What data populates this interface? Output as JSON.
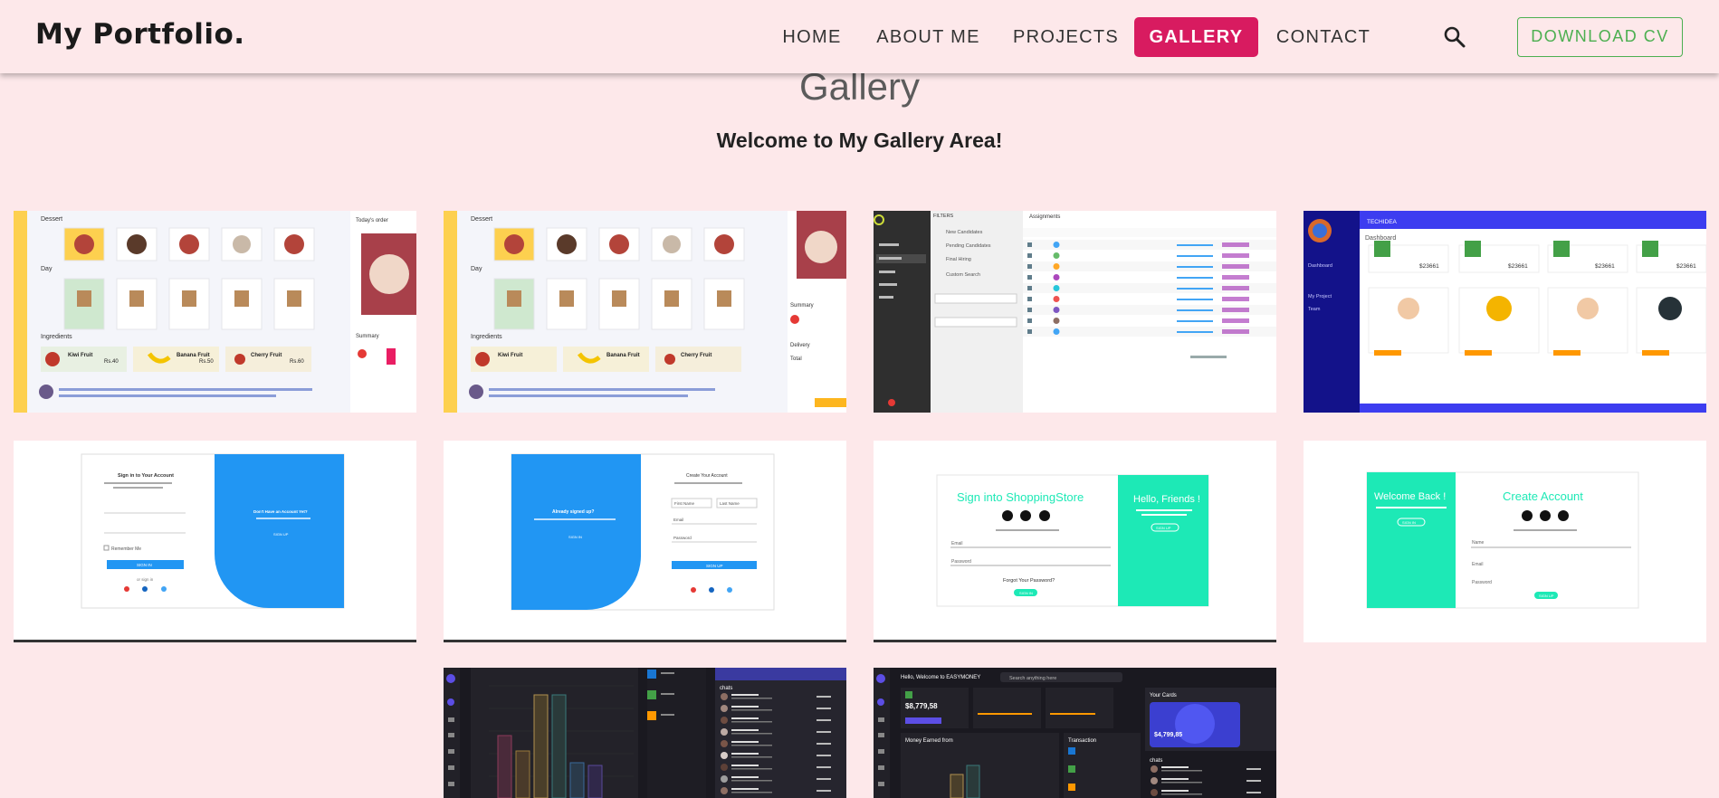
{
  "navbar": {
    "brand": "My Portfolio.",
    "items": [
      {
        "label": "HOME",
        "active": false
      },
      {
        "label": "ABOUT ME",
        "active": false
      },
      {
        "label": "PROJECTS",
        "active": false
      },
      {
        "label": "GALLERY",
        "active": true
      },
      {
        "label": "CONTACT",
        "active": false
      }
    ],
    "search_icon": "search-icon",
    "cv_button": "DOWNLOAD CV"
  },
  "page": {
    "title": "Gallery",
    "subtitle": "Welcome to My Gallery Area!"
  },
  "colors": {
    "background": "#fde8ea",
    "accent": "#d81b60",
    "cv_button": "#4caf50",
    "teal": "#1de9b6",
    "blue": "#2196f3",
    "indigo": "#3d3df0"
  },
  "gallery": {
    "shots": [
      {
        "name": "shot-food-app-1",
        "labels": [
          "Dessert",
          "Day",
          "Ingredients",
          "Today's order",
          "Summary",
          "Kiwi Fruit",
          "Banana Fruit",
          "Cherry Fruit",
          "Rs.40",
          "Rs.50",
          "Rs.60"
        ]
      },
      {
        "name": "shot-food-app-2",
        "labels": [
          "Dessert",
          "Day",
          "Ingredients",
          "Summary",
          "Delivery",
          "Total",
          "Kiwi Fruit",
          "Banana Fruit",
          "Cherry Fruit"
        ]
      },
      {
        "name": "shot-admin-table",
        "labels": [
          "FILTERS",
          "Assignments",
          "New Candidates",
          "Pending Candidates",
          "Final Hiring",
          "Custom Search"
        ]
      },
      {
        "name": "shot-dashboard-cards",
        "labels": [
          "TECHIDEA",
          "Dashboard",
          "$23661",
          "My Project",
          "Team"
        ]
      },
      {
        "name": "shot-signin-blue",
        "labels": [
          "Sign in to Your Account",
          "Don't Have an Account Yet?",
          "Email",
          "Password",
          "Remember Me",
          "SIGN IN",
          "SIGN UP"
        ]
      },
      {
        "name": "shot-signup-blue",
        "labels": [
          "Already signed up?",
          "Create Your Account",
          "First Name",
          "Last Name",
          "Email",
          "Password",
          "SIGN UP"
        ]
      },
      {
        "name": "shot-signin-teal",
        "labels": [
          "Sign into ShoppingStore",
          "Hello, Friends !",
          "Email",
          "Password",
          "Forgot Your Password?",
          "SIGN IN",
          "SIGN UP"
        ]
      },
      {
        "name": "shot-create-account-teal",
        "labels": [
          "Welcome Back !",
          "Create Account",
          "Name",
          "Email",
          "Password",
          "SIGN IN",
          "SIGN UP"
        ]
      },
      {
        "name": "shot-dark-chart",
        "labels": [
          "chats"
        ]
      },
      {
        "name": "shot-dark-finance",
        "labels": [
          "Hello, Welcome to EASYMONEY",
          "Search anything here",
          "$8,779,58",
          "$4,799,85",
          "Your Cards",
          "Money Earned from",
          "Transaction",
          "chats"
        ]
      }
    ]
  }
}
